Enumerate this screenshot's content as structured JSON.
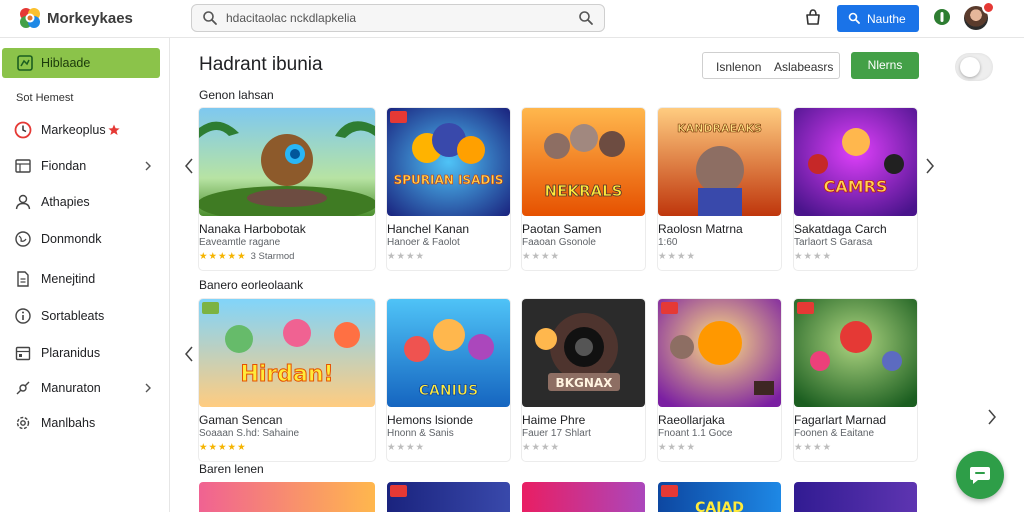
{
  "header": {
    "brand": "Morkeykaes",
    "search_text": "hdacitaolac nckdlapkelia",
    "top_button": "Nauthe",
    "accent": "#1a73e8"
  },
  "sidebar": {
    "items": [
      {
        "label": "Hiblaade",
        "icon": "grid-icon",
        "active": true
      },
      {
        "label": "Markeoplus",
        "icon": "clock-icon",
        "badge": true
      },
      {
        "label": "Fiondan",
        "icon": "list-icon",
        "chevron": true
      },
      {
        "label": "Athapies",
        "icon": "user-icon"
      },
      {
        "label": "Donmondk",
        "icon": "globe-icon"
      },
      {
        "label": "Menejtind",
        "icon": "document-icon"
      },
      {
        "label": "Sortableats",
        "icon": "info-icon"
      },
      {
        "label": "Plaranidus",
        "icon": "calendar-icon"
      },
      {
        "label": "Manuraton",
        "icon": "settings-icon",
        "chevron": true
      },
      {
        "label": "Manlbahs",
        "icon": "gear-icon"
      }
    ],
    "section_label": "Sot Hemest",
    "active_color": "#8bc34a"
  },
  "main": {
    "title": "Hadrant ibunia",
    "filter_left": "Isnlenon",
    "filter_right": "Aslabeasrs",
    "green_button": "Nlerns",
    "sections": [
      {
        "title": "Genon lahsan",
        "cards": [
          {
            "title": "Nanaka Harbobotak",
            "sub": "Eaveamtle ragane",
            "stars_gold": true,
            "rating_note": "3 Starmod"
          },
          {
            "title": "Hanchel Kanan",
            "sub": "Hanoer & Faolot",
            "stars_gold": false
          },
          {
            "title": "Paotan Samen",
            "sub": "Faaoan Gsonole",
            "stars_gold": false
          },
          {
            "title": "Raolosn Matrna",
            "sub": "1:60",
            "stars_gold": false
          },
          {
            "title": "Sakatdaga Carch",
            "sub": "Tarlaort S Garasa",
            "stars_gold": false
          }
        ],
        "thumb_texts": [
          "",
          "SPURIAN ISADIS",
          "NEKRALS",
          "KANDRAEAKS",
          "CAMRS"
        ]
      },
      {
        "title": "Banero eorleolaank",
        "cards": [
          {
            "title": "Gaman Sencan",
            "sub": "Soaaan S.hd: Sahaine",
            "stars_gold": true
          },
          {
            "title": "Hemons lsionde",
            "sub": "Hnonn & Sanis",
            "stars_gold": false
          },
          {
            "title": "Haime Phre",
            "sub": "Fauer 17 Shlart",
            "stars_gold": false
          },
          {
            "title": "Raeollarjaka",
            "sub": "Fnoant 1.1 Goce",
            "stars_gold": false
          },
          {
            "title": "Fagarlart Marnad",
            "sub": "Foonen & Eaitane",
            "stars_gold": false
          }
        ],
        "thumb_texts": [
          "Hirdan!",
          "CANIUS",
          "BKGNAX",
          "",
          ""
        ]
      },
      {
        "title": "Baren lenen",
        "thumb_texts": [
          "",
          "",
          "",
          "CAIAD",
          ""
        ]
      }
    ]
  },
  "colors": {
    "green_button": "#43a047",
    "chat_fab": "#2e9e48",
    "star_gold": "#f5b400"
  }
}
